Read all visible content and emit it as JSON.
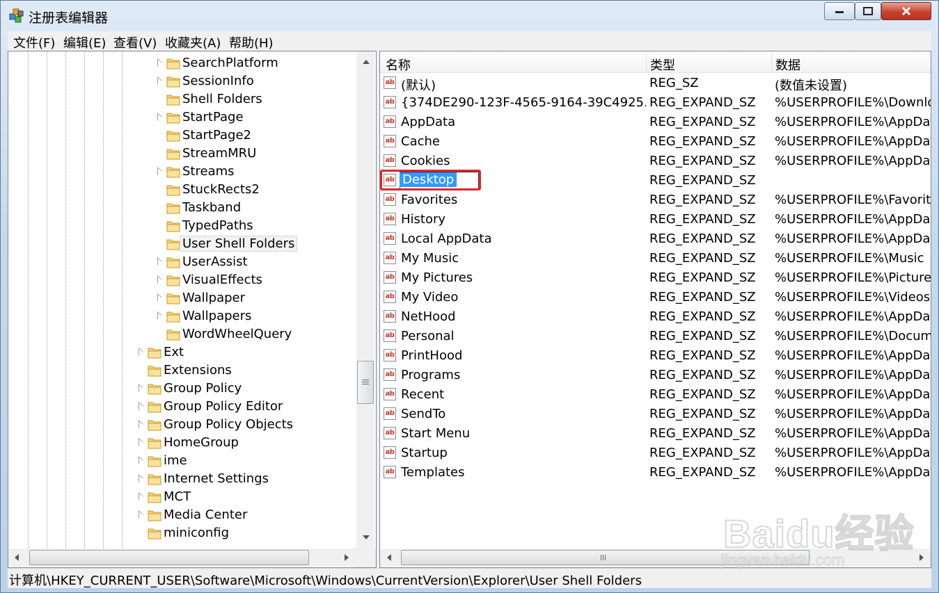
{
  "window": {
    "title": "注册表编辑器"
  },
  "menu": [
    "文件(F)",
    "编辑(E)",
    "查看(V)",
    "收藏夹(A)",
    "帮助(H)"
  ],
  "tree": {
    "items": [
      {
        "label": "SearchPlatform",
        "expandable": true
      },
      {
        "label": "SessionInfo",
        "expandable": true
      },
      {
        "label": "Shell Folders",
        "expandable": false
      },
      {
        "label": "StartPage",
        "expandable": true
      },
      {
        "label": "StartPage2",
        "expandable": false
      },
      {
        "label": "StreamMRU",
        "expandable": false
      },
      {
        "label": "Streams",
        "expandable": true
      },
      {
        "label": "StuckRects2",
        "expandable": false
      },
      {
        "label": "Taskband",
        "expandable": false
      },
      {
        "label": "TypedPaths",
        "expandable": false
      },
      {
        "label": "User Shell Folders",
        "expandable": false,
        "selected": true
      },
      {
        "label": "UserAssist",
        "expandable": true
      },
      {
        "label": "VisualEffects",
        "expandable": true
      },
      {
        "label": "Wallpaper",
        "expandable": true
      },
      {
        "label": "Wallpapers",
        "expandable": true
      },
      {
        "label": "WordWheelQuery",
        "expandable": false
      },
      {
        "label": "Ext",
        "expandable": true
      },
      {
        "label": "Extensions",
        "expandable": false
      },
      {
        "label": "Group Policy",
        "expandable": true
      },
      {
        "label": "Group Policy Editor",
        "expandable": true
      },
      {
        "label": "Group Policy Objects",
        "expandable": true
      },
      {
        "label": "HomeGroup",
        "expandable": true
      },
      {
        "label": "ime",
        "expandable": true
      },
      {
        "label": "Internet Settings",
        "expandable": true
      },
      {
        "label": "MCT",
        "expandable": true
      },
      {
        "label": "Media Center",
        "expandable": true
      },
      {
        "label": "miniconfig",
        "expandable": false
      }
    ]
  },
  "list": {
    "headers": {
      "name": "名称",
      "type": "类型",
      "data": "数据"
    },
    "rows": [
      {
        "name": "(默认)",
        "type": "REG_SZ",
        "data": "(数值未设置)"
      },
      {
        "name": "{374DE290-123F-4565-9164-39C4925...",
        "type": "REG_EXPAND_SZ",
        "data": "%USERPROFILE%\\Downloa"
      },
      {
        "name": "AppData",
        "type": "REG_EXPAND_SZ",
        "data": "%USERPROFILE%\\AppDat"
      },
      {
        "name": "Cache",
        "type": "REG_EXPAND_SZ",
        "data": "%USERPROFILE%\\AppDat"
      },
      {
        "name": "Cookies",
        "type": "REG_EXPAND_SZ",
        "data": "%USERPROFILE%\\AppDat"
      },
      {
        "name": "Desktop",
        "type": "REG_EXPAND_SZ",
        "data": "",
        "editing": true
      },
      {
        "name": "Favorites",
        "type": "REG_EXPAND_SZ",
        "data": "%USERPROFILE%\\Favorite"
      },
      {
        "name": "History",
        "type": "REG_EXPAND_SZ",
        "data": "%USERPROFILE%\\AppDat"
      },
      {
        "name": "Local AppData",
        "type": "REG_EXPAND_SZ",
        "data": "%USERPROFILE%\\AppDat"
      },
      {
        "name": "My Music",
        "type": "REG_EXPAND_SZ",
        "data": "%USERPROFILE%\\Music"
      },
      {
        "name": "My Pictures",
        "type": "REG_EXPAND_SZ",
        "data": "%USERPROFILE%\\Pictures"
      },
      {
        "name": "My Video",
        "type": "REG_EXPAND_SZ",
        "data": "%USERPROFILE%\\Videos"
      },
      {
        "name": "NetHood",
        "type": "REG_EXPAND_SZ",
        "data": "%USERPROFILE%\\AppDat"
      },
      {
        "name": "Personal",
        "type": "REG_EXPAND_SZ",
        "data": "%USERPROFILE%\\Docume"
      },
      {
        "name": "PrintHood",
        "type": "REG_EXPAND_SZ",
        "data": "%USERPROFILE%\\AppDat"
      },
      {
        "name": "Programs",
        "type": "REG_EXPAND_SZ",
        "data": "%USERPROFILE%\\AppDat"
      },
      {
        "name": "Recent",
        "type": "REG_EXPAND_SZ",
        "data": "%USERPROFILE%\\AppDat"
      },
      {
        "name": "SendTo",
        "type": "REG_EXPAND_SZ",
        "data": "%USERPROFILE%\\AppDat"
      },
      {
        "name": "Start Menu",
        "type": "REG_EXPAND_SZ",
        "data": "%USERPROFILE%\\AppDat"
      },
      {
        "name": "Startup",
        "type": "REG_EXPAND_SZ",
        "data": "%USERPROFILE%\\AppDat"
      },
      {
        "name": "Templates",
        "type": "REG_EXPAND_SZ",
        "data": "%USERPROFILE%\\AppDat"
      }
    ],
    "value_icon_text": "ab"
  },
  "status": "计算机\\HKEY_CURRENT_USER\\Software\\Microsoft\\Windows\\CurrentVersion\\Explorer\\User Shell Folders",
  "watermark": {
    "brand": "Baidu经验",
    "url": "jingyan.baidu.com"
  },
  "colors": {
    "selection": "#3399ff",
    "highlight_box": "#e0242b",
    "folder": "#f5d47a"
  }
}
